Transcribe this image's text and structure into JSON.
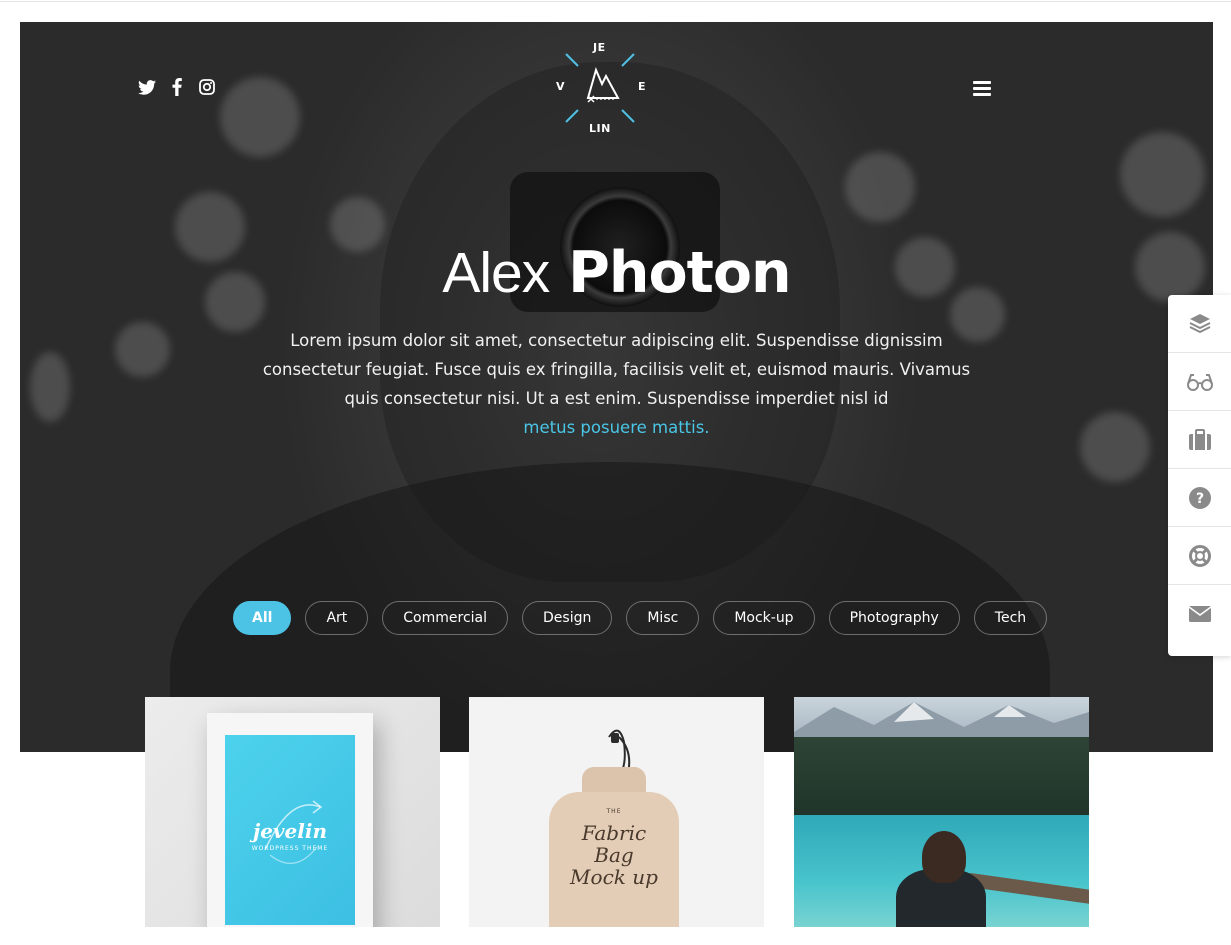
{
  "colors": {
    "accent": "#4cc2e4",
    "link": "#4ac6e6",
    "hero_bg": "#2f2f2f"
  },
  "header": {
    "social": [
      {
        "name": "twitter-icon"
      },
      {
        "name": "facebook-icon"
      },
      {
        "name": "instagram-icon"
      }
    ],
    "logo": {
      "top": "JE",
      "left": "V",
      "right": "E",
      "bottom": "LIN"
    },
    "menu_icon": "hamburger-menu-icon"
  },
  "hero": {
    "title_light": "Alex",
    "title_bold": "Photon",
    "description": "Lorem ipsum dolor sit amet, consectetur adipiscing elit. Suspendisse dignissim consectetur feugiat. Fusce quis ex fringilla, facilisis velit et, euismod mauris. Vivamus quis consectetur nisi. Ut a est enim. Suspendisse imperdiet nisl id",
    "link_text": "metus posuere mattis."
  },
  "filters": [
    "All",
    "Art",
    "Commercial",
    "Design",
    "Misc",
    "Mock-up",
    "Photography",
    "Tech"
  ],
  "active_filter": "All",
  "sidebar": [
    "layers-icon",
    "glasses-icon",
    "briefcase-icon",
    "help-circle-icon",
    "lifebuoy-icon",
    "envelope-icon"
  ],
  "portfolio": {
    "card1": {
      "brand": "jevelin",
      "subtitle": "WORDPRESS THEME"
    },
    "card2": {
      "small": "THE",
      "line1": "Fabric",
      "line2": "Bag",
      "line3": "Mock up"
    }
  }
}
